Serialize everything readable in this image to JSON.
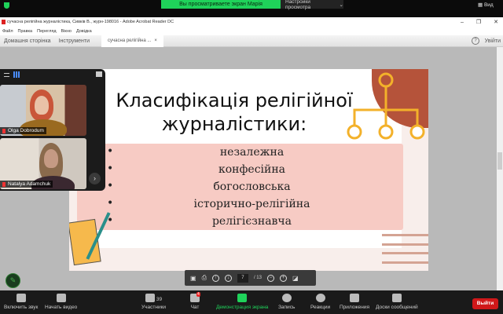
{
  "zoom_top": {
    "sharing_banner": "Вы просматриваете экран Марія",
    "view_options": "Настройки просмотра",
    "view_button": "Вид"
  },
  "acrobat": {
    "window_title": "сучасна релігійна журналістика, Сивків В., журн-198016 - Adobe Acrobat Reader DC",
    "menu": [
      "Файл",
      "Правка",
      "Перегляд",
      "Вікно",
      "Довідка"
    ],
    "tabs": {
      "home": "Домашня сторінка",
      "tools": "Інструменти",
      "document": "сучасна релігійна ..."
    },
    "help": "?",
    "login": "Увійти",
    "page_current": "7",
    "page_total": "/ 13"
  },
  "slide": {
    "title": "Класифікація релігійної журналістики:",
    "bullets": [
      "незалежна",
      "конфесійна",
      "богословська",
      "історично-релігійна",
      "релігієзнавча"
    ]
  },
  "participants_panel": {
    "tiles": [
      {
        "name": "Olga Dobrodum"
      },
      {
        "name": "Natalya Adamchuk"
      }
    ]
  },
  "zoom_toolbar": {
    "unmute": "Включить звук",
    "start_video": "Начать видео",
    "participants": "Участники",
    "participants_count": "39",
    "chat": "Чат",
    "chat_badge": "4",
    "share_screen": "Демонстрация экрана",
    "record": "Запись",
    "reactions": "Реакции",
    "apps": "Приложения",
    "whiteboards": "Доски сообщений",
    "leave": "Выйти"
  },
  "colors": {
    "zoom_green": "#1fd25a",
    "slide_pink": "#f7cbc4",
    "slide_brown": "#b5533a",
    "slide_gold": "#f3b12a",
    "leave_red": "#d0181a"
  }
}
